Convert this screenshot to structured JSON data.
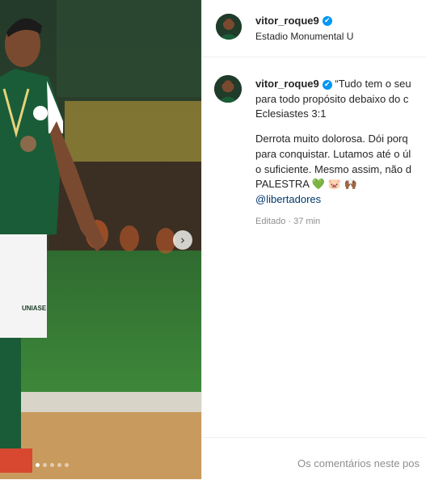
{
  "header": {
    "username": "vitor_roque9",
    "verified_mark": "✔",
    "location": "Estadio Monumental U"
  },
  "caption": {
    "username": "vitor_roque9",
    "line1": "“Tudo tem o seu",
    "line2": "para todo propósito debaixo do c",
    "line3": "Eclesiastes 3:1",
    "line4": "Derrota muito dolorosa. Dói porq",
    "line5": "para conquistar. Lutamos até o úl",
    "line6": "o suficiente. Mesmo assim, não d",
    "line7": "PALESTRA",
    "emoji_heart": "💚",
    "emoji_pig": "🐷",
    "emoji_hands": "🙌🏾",
    "mention": "@libertadores"
  },
  "meta": {
    "edited_time": "Editado · 37 min"
  },
  "footer": {
    "comments_text": "Os comentários neste pos"
  },
  "photo": {
    "next_arrow": "›",
    "carousel_total": 5,
    "carousel_active": 1,
    "jersey_text": "UNIASE"
  },
  "colors": {
    "jersey_green": "#1a5c37",
    "verified_blue": "#0095f6",
    "mention_blue": "#00376b",
    "muted_gray": "#8e8e8e"
  }
}
